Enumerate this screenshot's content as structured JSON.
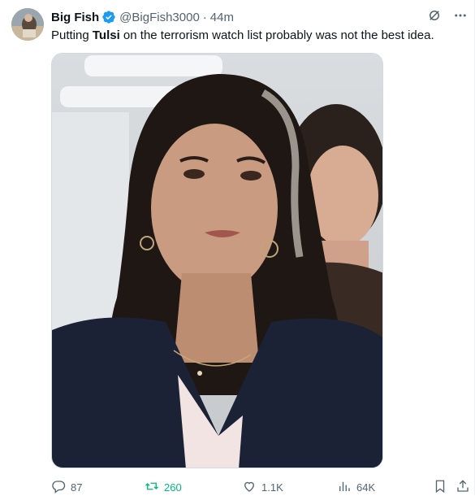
{
  "tweet": {
    "author_name": "Big Fish",
    "handle": "@BigFish3000",
    "separator": "·",
    "time": "44m",
    "text_before": "Putting ",
    "text_bold": "Tulsi",
    "text_after": " on the terrorism watch list probably was not the best idea."
  },
  "media": {
    "alt": "Photo of a woman with dark wavy hair and hoop earrings in a dark blazer, another woman behind her"
  },
  "actions": {
    "replies": "87",
    "retweets": "260",
    "likes": "1.1K",
    "views": "64K"
  },
  "colors": {
    "verified": "#1d9bf0",
    "retweet_active": "#00ba7c",
    "muted_text": "#536471"
  },
  "icons": {
    "verified": "verified-badge-icon",
    "grok": "grok-icon",
    "more": "more-icon",
    "reply": "reply-icon",
    "retweet": "retweet-icon",
    "like": "like-icon",
    "views": "views-icon",
    "bookmark": "bookmark-icon",
    "share": "share-icon"
  }
}
